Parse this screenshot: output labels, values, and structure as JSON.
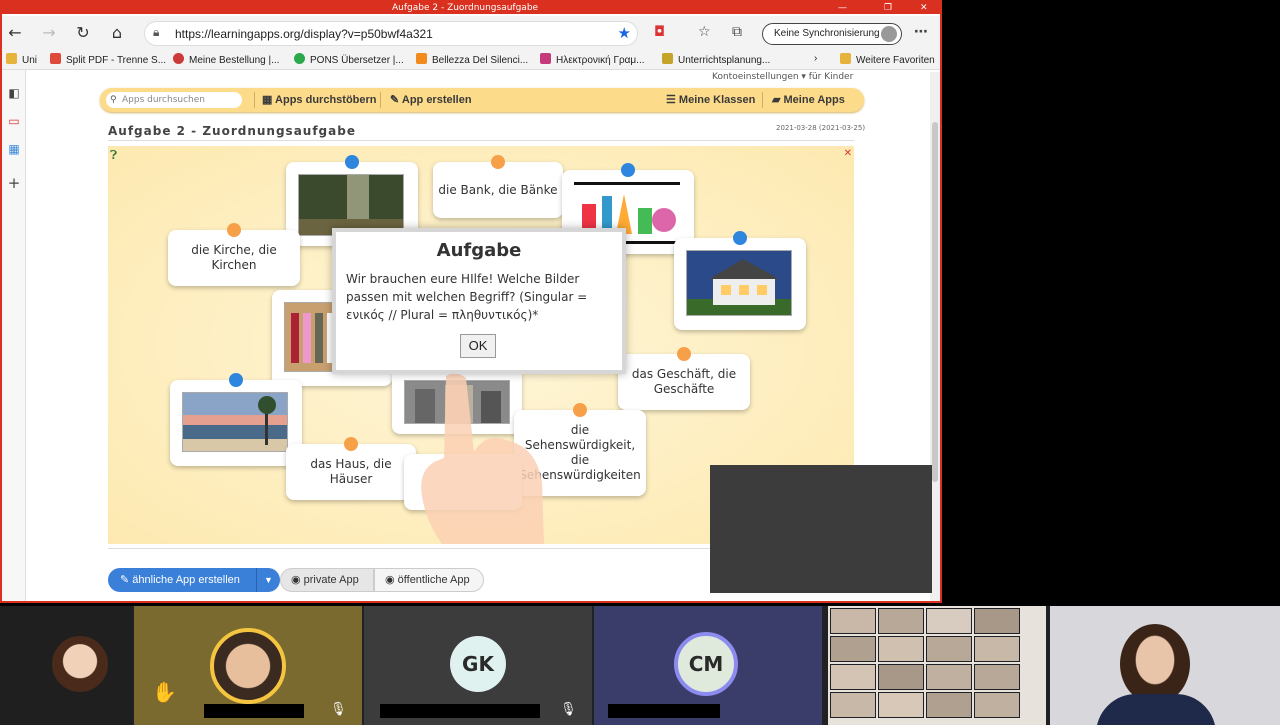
{
  "window": {
    "title": "Aufgabe 2 - Zuordnungsaufgabe",
    "controls": [
      "—",
      "❐",
      "✕"
    ]
  },
  "browser": {
    "url": "https://learningapps.org/display?v=p50bwf4a321",
    "sync_label": "Keine Synchronisierung",
    "bookmarks": [
      {
        "label": "Uni",
        "color": "#e6b43c"
      },
      {
        "label": "Split PDF - Trenne S...",
        "color": "#e04a3a"
      },
      {
        "label": "Meine Bestellung |...",
        "color": "#cc3a3a"
      },
      {
        "label": "PONS Übersetzer |...",
        "color": "#2aa84a"
      },
      {
        "label": "Bellezza Del Silenci...",
        "color": "#f28a1e"
      },
      {
        "label": "Ηλεκτρονική Γραμ...",
        "color": "#c43a7a"
      },
      {
        "label": "Unterrichtsplanung...",
        "color": "#c4a42a"
      }
    ],
    "bookmarks_more": "Weitere Favoriten"
  },
  "learningapps": {
    "top_strip": "Kontoeinstellungen ▾ für Kinder",
    "search_placeholder": "Apps durchsuchen",
    "nav": {
      "browse": "Apps durchstöbern",
      "create": "App erstellen",
      "classes": "Meine Klassen",
      "apps": "Meine Apps"
    },
    "app_title": "Aufgabe 2 - Zuordnungsaufgabe",
    "app_date": "2021-03-28",
    "app_date_small": "(2021-03-25)",
    "cards": {
      "kirche": "die Kirche, die Kirchen",
      "bank": "die Bank, die Bänke",
      "geschaeft": "das Geschäft, die Geschäfte",
      "haus": "das Haus, die Häuser",
      "sehens": "die Sehenswürdigkeit, die Sehenswürdigkeiten"
    },
    "dialog": {
      "title": "Aufgabe",
      "text": "Wir brauchen eure HIlfe! Welche Bilder passen mit welchen Begriff? (Singular = ενικός // Plural = πληθυντικός)*",
      "ok": "OK"
    },
    "footer": {
      "similar": "ähnliche App erstellen",
      "private": "private App",
      "public": "öffentliche App"
    }
  },
  "meeting": {
    "participants": [
      {
        "initials": "GK",
        "color": "#dff2f0"
      },
      {
        "initials": "CM",
        "color": "#dfeadc"
      }
    ],
    "raised_hand": "✋"
  },
  "colors": {
    "accent_red": "#d9301f",
    "nav_yellow": "#fcdc8a",
    "button_blue": "#3a7fd8"
  }
}
